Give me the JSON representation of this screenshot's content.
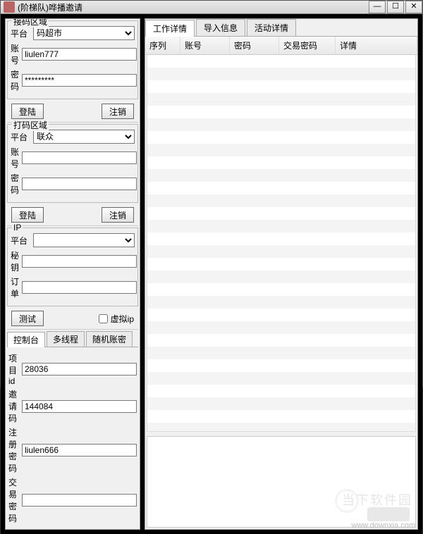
{
  "window": {
    "title": "(阶梯队)哗播邀请"
  },
  "titlebar_buttons": {
    "min": "—",
    "max": "☐",
    "close": "✕"
  },
  "receiver": {
    "title": "接码区域",
    "platform_label": "平台",
    "platform_value": "码超市",
    "account_label": "账号",
    "account_value": "liulen777",
    "password_label": "密码",
    "password_value": "*********",
    "login": "登陆",
    "logout": "注销"
  },
  "coder": {
    "title": "打码区域",
    "platform_label": "平台",
    "platform_value": "联众",
    "account_label": "账号",
    "account_value": "",
    "password_label": "密码",
    "password_value": "",
    "login": "登陆",
    "logout": "注销"
  },
  "ip": {
    "title": "IP",
    "platform_label": "平台",
    "platform_value": "",
    "key_label": "秘钥",
    "key_value": "",
    "order_label": "订单",
    "order_value": "",
    "test": "测试",
    "virtual_ip_label": "虚拟ip",
    "virtual_ip_checked": false
  },
  "bottom_tabs": {
    "console": "控制台",
    "thread": "多线程",
    "random": "随机账密"
  },
  "console": {
    "project_id_label": "项目id",
    "project_id_value": "28036",
    "invite_code_label": "邀请码",
    "invite_code_value": "144084",
    "reg_pwd_label": "注册密码",
    "reg_pwd_value": "liulen666",
    "trade_pwd_label": "交易密码",
    "trade_pwd_value": ""
  },
  "right_tabs": {
    "work": "工作详情",
    "import": "导入信息",
    "activity": "活动详情"
  },
  "table_headers": {
    "seq": "序列",
    "account": "账号",
    "password": "密码",
    "trade_pwd": "交易密码",
    "detail": "详情"
  },
  "watermark": {
    "site_cn": "当下软件园",
    "site_url": "www.downxia.com"
  }
}
